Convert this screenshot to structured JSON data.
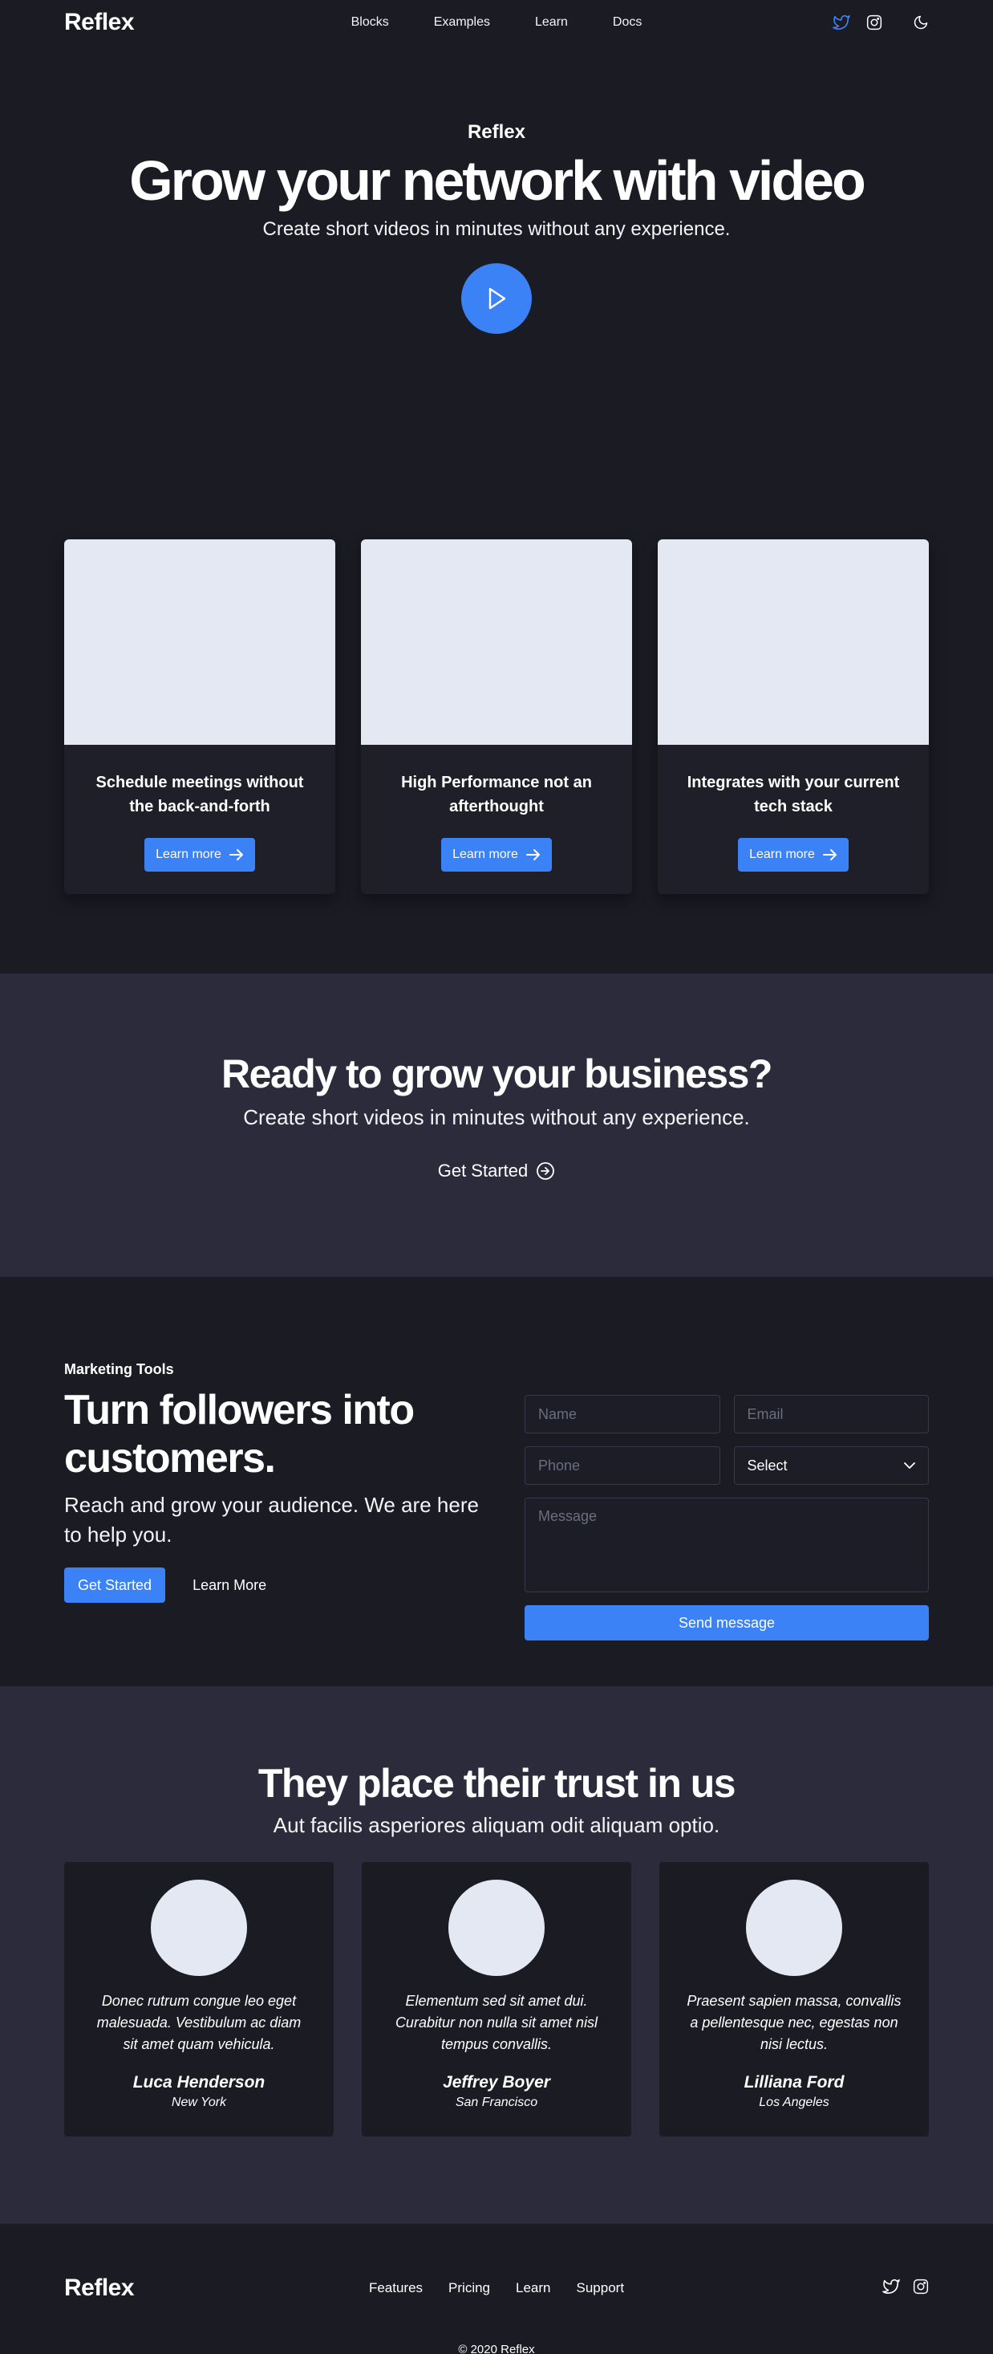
{
  "nav": {
    "logo": "Reflex",
    "links": [
      "Blocks",
      "Examples",
      "Learn",
      "Docs"
    ]
  },
  "hero": {
    "eyebrow": "Reflex",
    "title": "Grow your network with video",
    "subtitle": "Create short videos in minutes without any experience."
  },
  "features": [
    {
      "title": "Schedule meetings without the back-and-forth",
      "button": "Learn more"
    },
    {
      "title": "High Performance not an afterthought",
      "button": "Learn more"
    },
    {
      "title": "Integrates with your current tech stack",
      "button": "Learn more"
    }
  ],
  "cta": {
    "title": "Ready to grow your business?",
    "subtitle": "Create short videos in minutes without any experience.",
    "button": "Get Started"
  },
  "marketing": {
    "eyebrow": "Marketing Tools",
    "title": "Turn followers into customers.",
    "subtitle": "Reach and grow your audience. We are here to help you.",
    "primary": "Get Started",
    "secondary": "Learn More",
    "form": {
      "name_placeholder": "Name",
      "email_placeholder": "Email",
      "phone_placeholder": "Phone",
      "select_value": "Select",
      "message_placeholder": "Message",
      "submit": "Send message"
    }
  },
  "trust": {
    "title": "They place their trust in us",
    "subtitle": "Aut facilis asperiores aliquam odit aliquam optio.",
    "testimonials": [
      {
        "quote": "Donec rutrum congue leo eget malesuada. Vestibulum ac diam sit amet quam vehicula.",
        "name": "Luca Henderson",
        "city": "New York"
      },
      {
        "quote": "Elementum sed sit amet dui. Curabitur non nulla sit amet nisl tempus convallis.",
        "name": "Jeffrey Boyer",
        "city": "San Francisco"
      },
      {
        "quote": "Praesent sapien massa, convallis a pellentesque nec, egestas non nisi lectus.",
        "name": "Lilliana Ford",
        "city": "Los Angeles"
      }
    ]
  },
  "footer": {
    "logo": "Reflex",
    "links": [
      "Features",
      "Pricing",
      "Learn",
      "Support"
    ],
    "copyright": "© 2020 Reflex"
  },
  "colors": {
    "accent": "#3b82f6",
    "bg": "#1a1b23",
    "band": "#2b2b3c",
    "twitter_icon": "#3b82f6"
  },
  "icons": [
    "twitter-icon",
    "instagram-icon",
    "moon-icon",
    "play-icon",
    "arrow-right-icon",
    "arrow-circle-right-icon",
    "chevron-down-icon"
  ]
}
